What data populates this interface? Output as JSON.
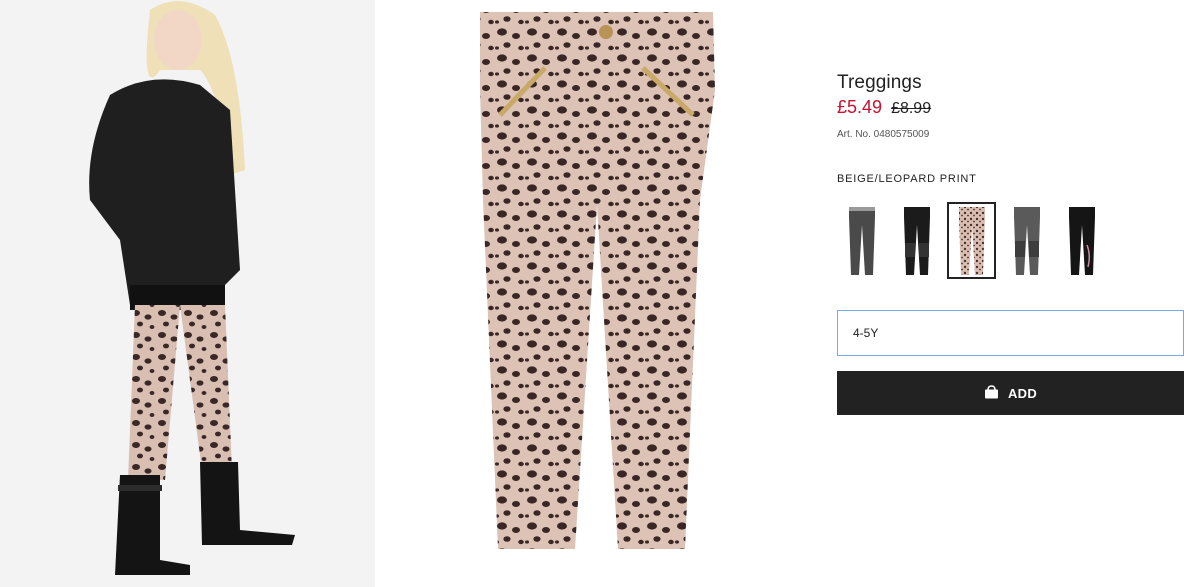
{
  "product": {
    "title": "Treggings",
    "price_now": "£5.49",
    "price_old": "£8.99",
    "art_no": "Art. No. 0480575009",
    "color_name": "BEIGE/LEOPARD PRINT"
  },
  "swatches": [
    {
      "name": "grey-jeggings",
      "color": "#4a4a4a",
      "selected": false
    },
    {
      "name": "black-zip-treggings",
      "color": "#1b1b1b",
      "selected": false
    },
    {
      "name": "beige-leopard-treggings",
      "color": "#c9a99a",
      "selected": true
    },
    {
      "name": "dark-grey-patch-treggings",
      "color": "#5a5a5a",
      "selected": false
    },
    {
      "name": "black-print-treggings",
      "color": "#151515",
      "selected": false
    }
  ],
  "size_select": {
    "value": "4-5Y"
  },
  "add_button": {
    "label": "ADD",
    "icon": "shopping-bag-icon"
  },
  "colors": {
    "sale_red": "#c8102e",
    "button_bg": "#222222",
    "select_border": "#7aa7e8"
  }
}
